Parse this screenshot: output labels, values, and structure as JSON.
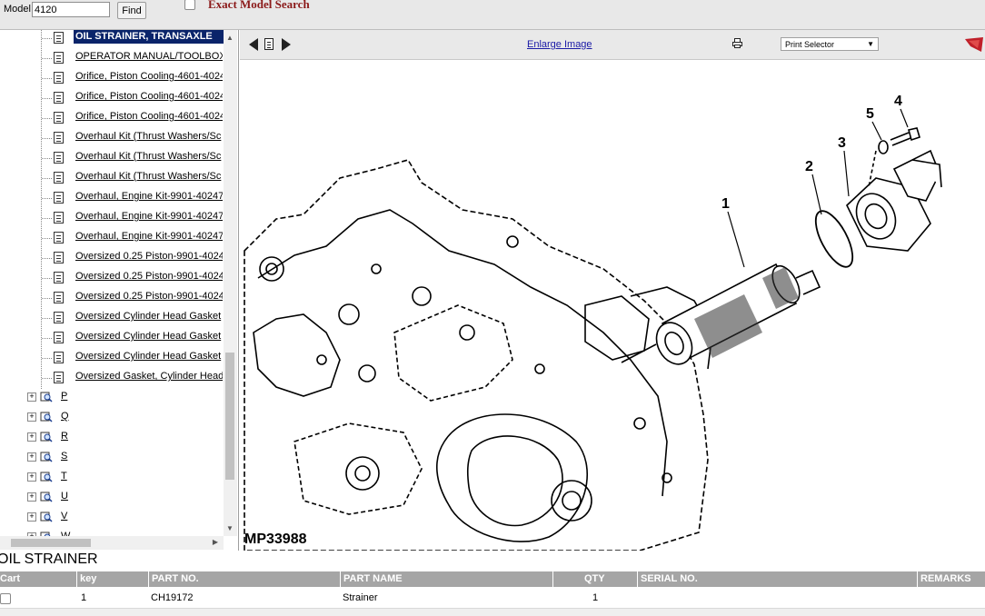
{
  "top": {
    "model_label": "Model",
    "model_value": "4120",
    "find_label": "Find",
    "exact_search_label": "Exact Model Search"
  },
  "tree": {
    "items": [
      {
        "label": "OIL STRAINER, TRANSAXLE",
        "selected": true
      },
      {
        "label": "OPERATOR MANUAL/TOOLBOX"
      },
      {
        "label": "Orifice, Piston Cooling-4601-4024"
      },
      {
        "label": "Orifice, Piston Cooling-4601-4024"
      },
      {
        "label": "Orifice, Piston Cooling-4601-4024"
      },
      {
        "label": "Overhaul Kit (Thrust Washers/Sc"
      },
      {
        "label": "Overhaul Kit (Thrust Washers/Sc"
      },
      {
        "label": "Overhaul Kit (Thrust Washers/Sc"
      },
      {
        "label": "Overhaul, Engine Kit-9901-40247"
      },
      {
        "label": "Overhaul, Engine Kit-9901-40247"
      },
      {
        "label": "Overhaul, Engine Kit-9901-40247"
      },
      {
        "label": "Oversized 0.25 Piston-9901-4024"
      },
      {
        "label": "Oversized 0.25 Piston-9901-4024"
      },
      {
        "label": "Oversized 0.25 Piston-9901-4024"
      },
      {
        "label": "Oversized Cylinder Head Gasket"
      },
      {
        "label": "Oversized Cylinder Head Gasket"
      },
      {
        "label": "Oversized Cylinder Head Gasket"
      },
      {
        "label": "Oversized Gasket, Cylinder Head"
      }
    ],
    "letters": [
      "P",
      "Q",
      "R",
      "S",
      "T",
      "U",
      "V",
      "W"
    ]
  },
  "viewer": {
    "enlarge_label": "Enlarge Image",
    "print_select_label": "Print Selector",
    "figure_id": "MP33988",
    "callouts": [
      "1",
      "2",
      "3",
      "4",
      "5"
    ]
  },
  "parts": {
    "title": "OIL STRAINER",
    "headers": {
      "cart": "Cart",
      "key": "key",
      "part_no": "PART NO.",
      "part_name": "PART NAME",
      "qty": "QTY",
      "serial": "SERIAL NO.",
      "remarks": "REMARKS"
    },
    "rows": [
      {
        "key": "1",
        "part_no": "CH19172",
        "part_name": "Strainer",
        "qty": "1",
        "serial": "",
        "remarks": ""
      }
    ]
  },
  "colors": {
    "selection": "#0a246a",
    "header_bg": "#a5a5a5",
    "exact_search": "#8b1a1a",
    "link": "#1a1aa6"
  },
  "icons": [
    "document-icon",
    "folder-search-icon",
    "expand-plus-icon",
    "prev-arrow-icon",
    "page-icon",
    "next-arrow-icon",
    "printer-icon",
    "logo-icon"
  ]
}
